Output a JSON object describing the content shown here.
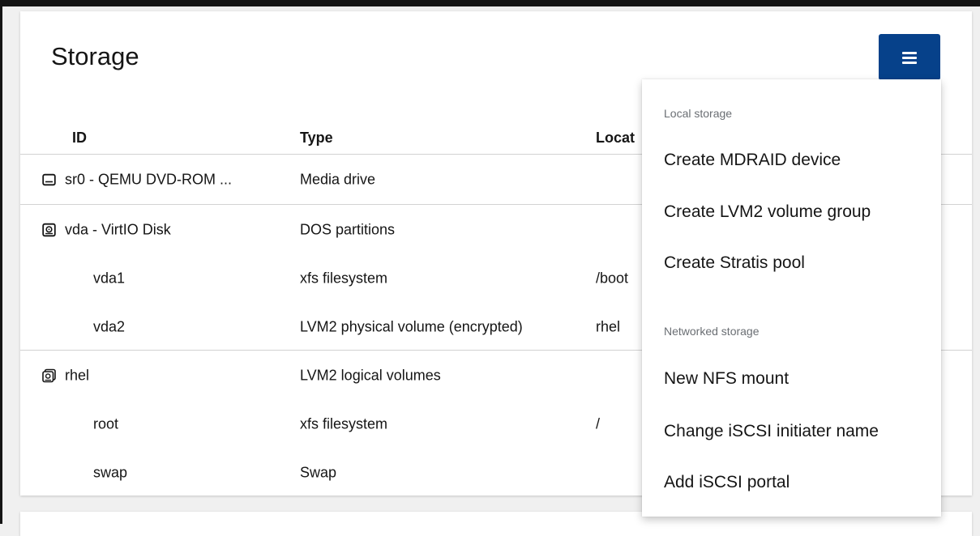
{
  "page": {
    "title": "Storage",
    "menu_button_icon": "menu-bars-icon"
  },
  "table": {
    "headers": [
      "ID",
      "Type",
      "Locat"
    ],
    "rows": [
      {
        "id": "sr0 - QEMU DVD-ROM ...",
        "type": "Media drive",
        "location": "",
        "icon": "optical-drive-icon"
      },
      {
        "id": "vda - VirtIO Disk",
        "type": "DOS partitions",
        "location": "",
        "icon": "hard-disk-icon"
      },
      {
        "id": "vda1",
        "type": "xfs filesystem",
        "location": "/boot",
        "icon": ""
      },
      {
        "id": "vda2",
        "type": "LVM2 physical volume (encrypted)",
        "location": "rhel",
        "icon": ""
      },
      {
        "id": "rhel",
        "type": "LVM2 logical volumes",
        "location": "",
        "icon": "volume-group-icon"
      },
      {
        "id": "root",
        "type": "xfs filesystem",
        "location": "/",
        "icon": ""
      },
      {
        "id": "swap",
        "type": "Swap",
        "location": "",
        "icon": ""
      }
    ]
  },
  "dropdown": {
    "local_title": "Local storage",
    "local_items": [
      "Create MDRAID device",
      "Create LVM2 volume group",
      "Create Stratis pool"
    ],
    "network_title": "Networked storage",
    "network_items": [
      "New NFS mount",
      "Change iSCSI initiater name",
      "Add iSCSI portal"
    ]
  },
  "colors": {
    "accent": "#06418a",
    "text": "#151515",
    "muted": "#6a6e73",
    "divider": "#d2d2d2"
  }
}
